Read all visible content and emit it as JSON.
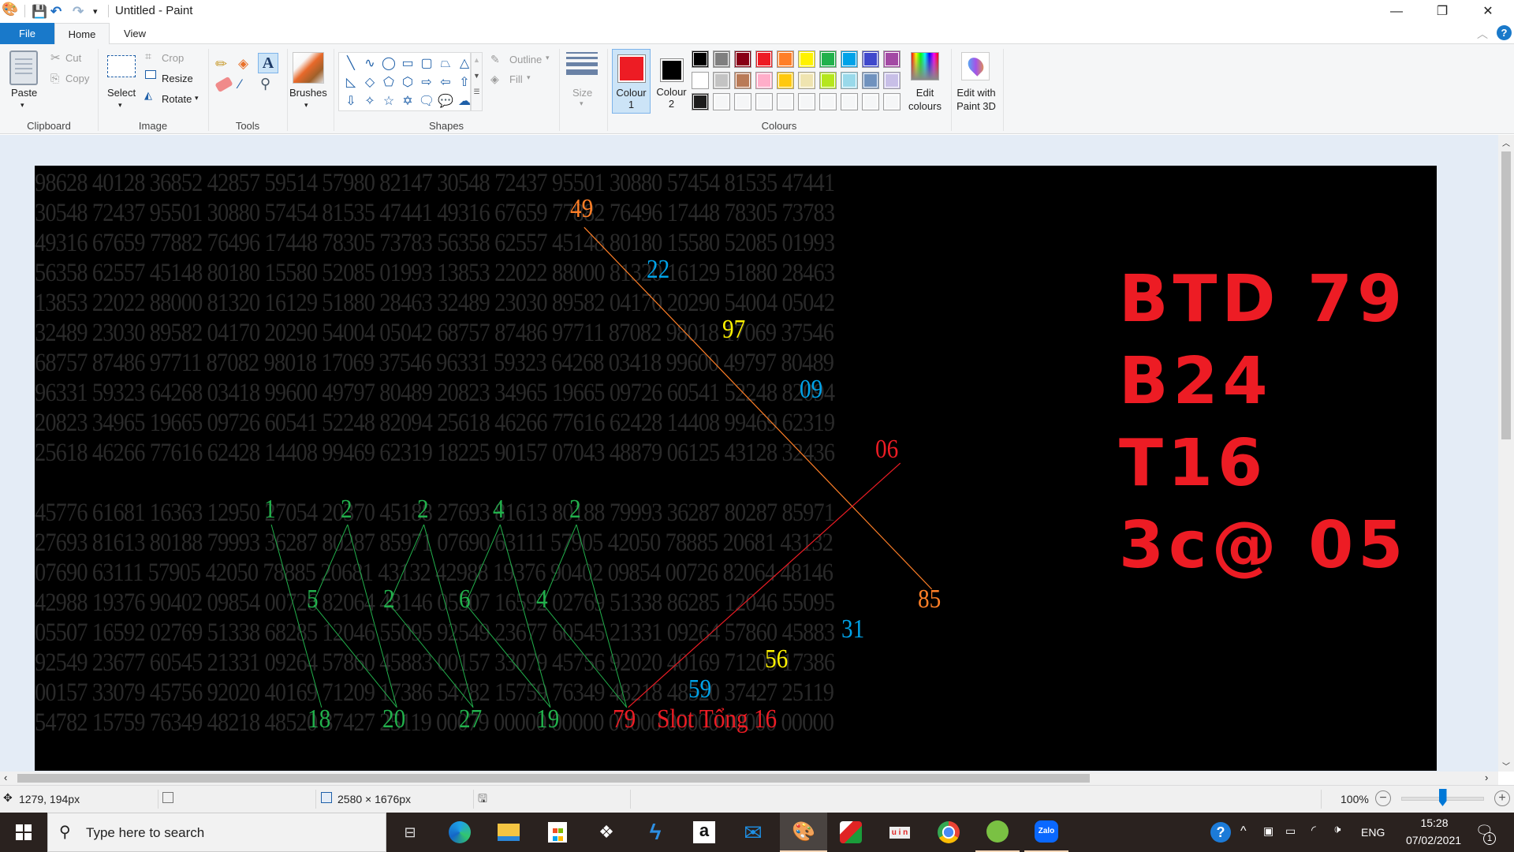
{
  "window": {
    "title": "Untitled - Paint",
    "controls": {
      "minimize": "—",
      "restore": "❐",
      "close": "✕"
    }
  },
  "tabs": [
    {
      "label": "File",
      "active": false
    },
    {
      "label": "Home",
      "active": true
    },
    {
      "label": "View",
      "active": false
    }
  ],
  "ribbon": {
    "clipboard": {
      "label": "Clipboard",
      "paste": "Paste",
      "cut": "Cut",
      "copy": "Copy"
    },
    "image": {
      "label": "Image",
      "select": "Select",
      "crop": "Crop",
      "resize": "Resize",
      "rotate": "Rotate"
    },
    "tools": {
      "label": "Tools"
    },
    "brushes": {
      "label": "Brushes"
    },
    "shapes": {
      "label": "Shapes",
      "outline": "Outline",
      "fill": "Fill"
    },
    "size": {
      "label": "Size"
    },
    "colour1": {
      "label": "Colour",
      "num": "1",
      "color": "#ed1c24"
    },
    "colour2": {
      "label": "Colour",
      "num": "2",
      "color": "#000000"
    },
    "colours": {
      "label": "Colours",
      "row1": [
        "#000000",
        "#7f7f7f",
        "#880015",
        "#ed1c24",
        "#ff7f27",
        "#fff200",
        "#22b14c",
        "#00a2e8",
        "#3f48cc",
        "#a349a4"
      ],
      "row2": [
        "#ffffff",
        "#c3c3c3",
        "#b97a57",
        "#ffaec9",
        "#ffc90e",
        "#efe4b0",
        "#b5e61d",
        "#99d9ea",
        "#7092be",
        "#c8bfe7"
      ],
      "row3": [
        "#1c1c1c",
        "#f5f6f7",
        "#f5f6f7",
        "#f5f6f7",
        "#f5f6f7",
        "#f5f6f7",
        "#f5f6f7",
        "#f5f6f7",
        "#f5f6f7",
        "#f5f6f7"
      ]
    },
    "edit_colours": {
      "line1": "Edit",
      "line2": "colours"
    },
    "paint3d": {
      "line1": "Edit with",
      "line2": "Paint 3D"
    }
  },
  "canvas": {
    "rows": [
      "98628 40128 36852 42857 59514 57980 82147 30548 72437 95501 30880 57454 81535 47441",
      "30548 72437 95501 30880 57454 81535 47441 49316 67659 77882 76496 17448 78305 73783",
      "49316 67659 77882 76496 17448 78305 73783 56358 62557 45148 80180 15580 52085 01993",
      "56358 62557 45148 80180 15580 52085 01993 13853 22022 88000 81320 16129 51880 28463",
      "13853 22022 88000 81320 16129 51880 28463 32489 23030 89582 04170 20290 54004 05042",
      "32489 23030 89582 04170 20290 54004 05042 68757 87486 97711 87082 98018 17069 37546",
      "68757 87486 97711 87082 98018 17069 37546 96331 59323 64268 03418 99600 49797 80489",
      "96331 59323 64268 03418 99600 49797 80489 20823 34965 19665 09726 60541 52248 82094",
      "20823 34965 19665 09726 60541 52248 82094 25618 46266 77616 62428 14408 99469 62319",
      "25618 46266 77616 62428 14408 99469 62319 18225 90157 07043 48879 06125 43128 32436",
      "",
      "45776 61681 16363 12950 27054 20370 45188 27693 81613 80188 79993 36287 80287 85971",
      "27693 81613 80188 79993 36287 80287 85971 07690 63111 57905 42050 78885 20681 43132",
      "07690 63111 57905 42050 78885 20681 43132 42988 19376 90402 09854 00726 82064 48146",
      "42988 19376 90402 09854 00726 82064 48146 05507 16592 02769 51338 86285 12046 55095",
      "05507 16592 02769 51338 68285 12046 55095 92549 23677 60545 21331 09264 57860 45883",
      "92549 23677 60545 21331 09264 57860 45883 00157 33079 45756 92020 40169 71209 17386",
      "00157 33079 45756 92020 40169 71209 17386 54782 15759 76349 48218 48520 37427 25119",
      "54782 15759 76349 48218 48520 37427 25119 00079 00000 00000 00000 00000 00000 00000"
    ],
    "highlights": [
      {
        "text": "49",
        "color": "#ff7f27"
      },
      {
        "text": "22",
        "color": "#00a2e8"
      },
      {
        "text": "97",
        "color": "#fff200"
      },
      {
        "text": "09",
        "color": "#00a2e8"
      },
      {
        "text": "06",
        "color": "#ed1c24"
      },
      {
        "text": "85",
        "color": "#ff7f27"
      },
      {
        "text": "31",
        "color": "#00a2e8"
      },
      {
        "text": "56",
        "color": "#fff200"
      },
      {
        "text": "59",
        "color": "#00a2e8"
      },
      {
        "text": "79",
        "color": "#ed1c24"
      },
      {
        "text": "Slot Tổng 16",
        "color": "#ed1c24"
      },
      {
        "text": "1",
        "color": "#22b14c"
      },
      {
        "text": "2",
        "color": "#22b14c"
      },
      {
        "text": "2",
        "color": "#22b14c"
      },
      {
        "text": "4",
        "color": "#22b14c"
      },
      {
        "text": "2",
        "color": "#22b14c"
      },
      {
        "text": "5",
        "color": "#22b14c"
      },
      {
        "text": "2",
        "color": "#22b14c"
      },
      {
        "text": "6",
        "color": "#22b14c"
      },
      {
        "text": "4",
        "color": "#22b14c"
      },
      {
        "text": "18",
        "color": "#22b14c"
      },
      {
        "text": "20",
        "color": "#22b14c"
      },
      {
        "text": "27",
        "color": "#22b14c"
      },
      {
        "text": "19",
        "color": "#22b14c"
      }
    ],
    "big_text": [
      "BTD 79",
      "B24",
      "T16",
      "3c@ 05"
    ],
    "big_text_color": "#ed1c24"
  },
  "statusbar": {
    "cursor_pos": "1279, 194px",
    "image_size": "2580 × 1676px",
    "zoom": "100%",
    "zoom_level_percent": 100
  },
  "taskbar": {
    "search_placeholder": "Type here to search",
    "apps": [
      "task-view",
      "edge",
      "file-explorer",
      "store",
      "dropbox",
      "app-bolt",
      "amazon",
      "mail",
      "paint",
      "fastone-capture",
      "unikey",
      "chrome",
      "coc-coc",
      "zalo"
    ],
    "lang": "ENG",
    "time": "15:28",
    "date": "07/02/2021",
    "notifications": "1"
  }
}
